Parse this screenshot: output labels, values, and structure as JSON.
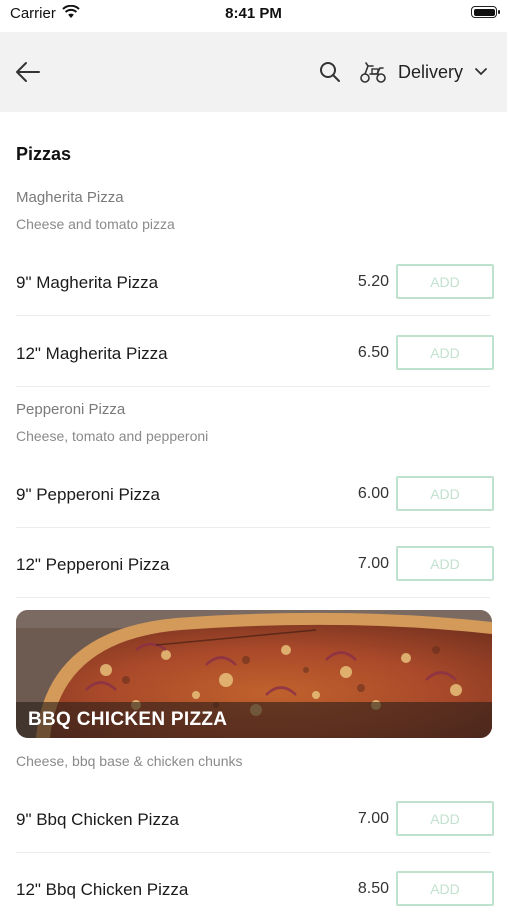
{
  "status": {
    "carrier": "Carrier",
    "time": "8:41 PM"
  },
  "nav": {
    "delivery_label": "Delivery"
  },
  "section": {
    "title": "Pizzas"
  },
  "items": [
    {
      "name": "Magherita Pizza",
      "description": "Cheese and tomato pizza",
      "options": [
        {
          "label": "9\" Magherita Pizza",
          "price": "5.20",
          "button": "ADD"
        },
        {
          "label": "12\" Magherita Pizza",
          "price": "6.50",
          "button": "ADD"
        }
      ]
    },
    {
      "name": "Pepperoni Pizza",
      "description": "Cheese, tomato and pepperoni",
      "options": [
        {
          "label": "9\" Pepperoni Pizza",
          "price": "6.00",
          "button": "ADD"
        },
        {
          "label": "12\" Pepperoni Pizza",
          "price": "7.00",
          "button": "ADD"
        }
      ]
    },
    {
      "name": "BBQ CHICKEN PIZZA",
      "description": "Cheese, bbq base & chicken chunks",
      "options": [
        {
          "label": "9\" Bbq Chicken Pizza",
          "price": "7.00",
          "button": "ADD"
        },
        {
          "label": "12\" Bbq Chicken Pizza",
          "price": "8.50",
          "button": "ADD"
        }
      ]
    }
  ],
  "icons": {
    "back": "arrow-left-icon",
    "search": "search-icon",
    "delivery": "scooter-icon",
    "dropdown": "chevron-down-icon",
    "wifi": "wifi-icon",
    "battery": "battery-icon"
  },
  "colors": {
    "accent": "#bfe2ce",
    "nav_bg": "#f2f2f2",
    "muted_text": "#8a8a8a"
  }
}
